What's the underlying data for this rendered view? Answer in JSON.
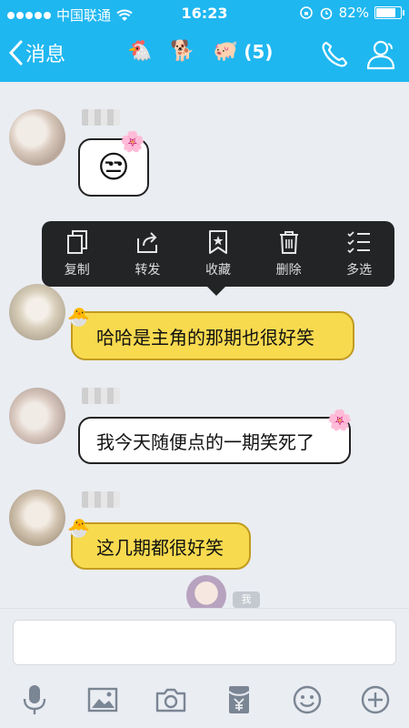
{
  "statusbar": {
    "carrier": "中国联通",
    "time": "16:23",
    "battery_percent": "82%",
    "battery_level": 0.82,
    "icons": [
      "signal-dots",
      "wifi-icon",
      "rotation-lock-icon",
      "alarm-icon",
      "battery-icon"
    ]
  },
  "navbar": {
    "back_label": "消息",
    "emojis": [
      "🐔",
      "🐕",
      "🐖"
    ],
    "count": "(5)",
    "icons": [
      "back-chevron-icon",
      "phone-icon",
      "contact-icon"
    ]
  },
  "context_menu": {
    "items": [
      {
        "label": "复制",
        "icon": "copy-icon"
      },
      {
        "label": "转发",
        "icon": "forward-icon"
      },
      {
        "label": "收藏",
        "icon": "bookmark-icon"
      },
      {
        "label": "删除",
        "icon": "trash-icon"
      },
      {
        "label": "多选",
        "icon": "multiselect-icon"
      }
    ]
  },
  "messages": [
    {
      "type": "sticker",
      "content": "😒",
      "style": "white"
    },
    {
      "type": "text",
      "text": "哈哈是主角的那期也很好笑",
      "style": "yellow"
    },
    {
      "type": "text",
      "text": "我今天随便点的一期笑死了",
      "style": "white"
    },
    {
      "type": "text",
      "text": "这几期都很好笑",
      "style": "yellow"
    }
  ],
  "self_badge": "我",
  "input": {
    "placeholder": "",
    "value": ""
  },
  "toolbar": {
    "icons": [
      "microphone-icon",
      "image-icon",
      "camera-icon",
      "red-packet-icon",
      "emoji-icon",
      "plus-icon"
    ]
  },
  "colors": {
    "accent": "#1fb7f0",
    "yellow_bubble": "#f8da4f",
    "menu_bg": "#222426"
  }
}
